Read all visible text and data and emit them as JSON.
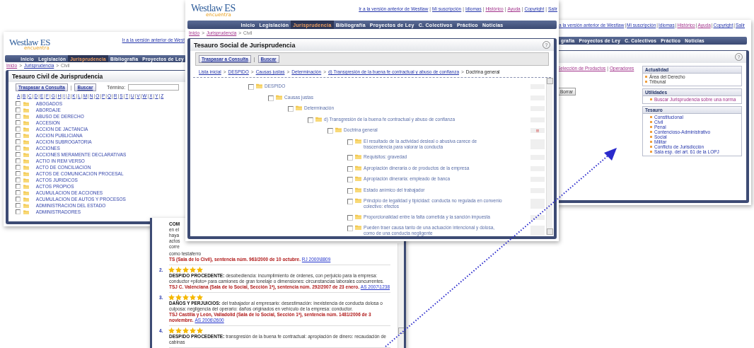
{
  "left_window": {
    "logo": {
      "brand": "Westlaw ES",
      "tagline": "encuentra"
    },
    "top_link": "Ir a la versión anterior de West",
    "nav": [
      {
        "label": "Inicio",
        "selected": false
      },
      {
        "label": "Legislación",
        "selected": false
      },
      {
        "label": "Jurisprudencia",
        "selected": true
      },
      {
        "label": "Bibliografía",
        "selected": false
      },
      {
        "label": "Proyectos de Ley",
        "selected": false
      }
    ],
    "breadcrumb": {
      "separator": ">",
      "items": [
        {
          "label": "Inicio",
          "kind": "visited"
        },
        {
          "label": "Jurisprudencia",
          "kind": "link"
        },
        {
          "label": "Civil",
          "kind": "text"
        }
      ]
    },
    "title": "Tesauro Civil de Jurisprudencia",
    "buttons": [
      "Traspasar a Consulta",
      "Buscar"
    ],
    "button_separator": "|",
    "search": {
      "label": "Término:"
    },
    "letters": {
      "separator": "|",
      "items": [
        "A",
        "B",
        "C",
        "D",
        "E",
        "F",
        "G",
        "H",
        "I",
        "J",
        "K",
        "L",
        "M",
        "N",
        "O",
        "P",
        "Q",
        "R",
        "S",
        "T",
        "U",
        "V",
        "W",
        "X",
        "Y",
        "Z"
      ]
    },
    "items": [
      {
        "label": "ABOGADOS",
        "checked": false
      },
      {
        "label": "ABORDAJE",
        "checked": false
      },
      {
        "label": "ABUSO DE DERECHO",
        "checked": false
      },
      {
        "label": "ACCESION",
        "checked": false
      },
      {
        "label": "ACCION DE JACTANCIA",
        "checked": false
      },
      {
        "label": "ACCION PUBLICIANA",
        "checked": false
      },
      {
        "label": "ACCION SUBROGATORIA",
        "checked": false
      },
      {
        "label": "ACCIONES",
        "checked": false
      },
      {
        "label": "ACCIONES MERAMENTE DECLARATIVAS",
        "checked": false
      },
      {
        "label": "ACTIO IN REM VERSO",
        "checked": false
      },
      {
        "label": "ACTO DE CONCILIACION",
        "checked": false
      },
      {
        "label": "ACTOS DE COMUNICACION PROCESAL",
        "checked": false
      },
      {
        "label": "ACTOS JURIDICOS",
        "checked": false
      },
      {
        "label": "ACTOS PROPIOS",
        "checked": false
      },
      {
        "label": "ACUMULACION DE ACCIONES",
        "checked": false
      },
      {
        "label": "ACUMULACION DE AUTOS Y PROCESOS",
        "checked": false
      },
      {
        "label": "ADMINISTRACION DEL ESTADO",
        "checked": false
      },
      {
        "label": "ADMINISTRADORES",
        "checked": false
      }
    ]
  },
  "right_window": {
    "top_links": {
      "separator": "|",
      "items": [
        {
          "label": "a la versión anterior de Westlaw",
          "visited": false
        },
        {
          "label": "Mi suscripción",
          "visited": false
        },
        {
          "label": "Idiomas",
          "visited": false
        },
        {
          "label": "Histórico",
          "visited": true
        },
        {
          "label": "Ayuda",
          "visited": true
        },
        {
          "label": "Copyright",
          "visited": false
        },
        {
          "label": "Salir",
          "visited": false
        }
      ]
    },
    "nav": [
      {
        "label": "grafía",
        "selected": false
      },
      {
        "label": "Proyectos de Ley",
        "selected": false
      },
      {
        "label": "C. Colectivos",
        "selected": false
      },
      {
        "label": "Práctico",
        "selected": false
      },
      {
        "label": "Noticias",
        "selected": false
      }
    ],
    "help": "?",
    "links": {
      "separator": "|",
      "items": [
        {
          "label": "Selección de Productos",
          "visited": true
        },
        {
          "label": "Operadores",
          "visited": true
        }
      ]
    },
    "button": "Borrar",
    "boxes": [
      {
        "title": "Actualidad",
        "items": [
          {
            "label": "Área del Derecho",
            "kind": "text"
          },
          {
            "label": "Tribunal",
            "kind": "text"
          }
        ]
      },
      {
        "title": "Utilidades",
        "items": [
          {
            "label": "Buscar Jurisprudencia sobre una norma",
            "kind": "visited"
          }
        ]
      },
      {
        "title": "Tesauro",
        "items": [
          {
            "label": "Constitucional",
            "kind": "link"
          },
          {
            "label": "Civil",
            "kind": "link"
          },
          {
            "label": "Penal",
            "kind": "link"
          },
          {
            "label": "Contencioso-Administrativo",
            "kind": "link"
          },
          {
            "label": "Social",
            "kind": "link"
          },
          {
            "label": "Militar",
            "kind": "link"
          },
          {
            "label": "Conflicto de Jurisdicción",
            "kind": "link"
          },
          {
            "label": "Sala esp. del art. 61 de la LOPJ",
            "kind": "link"
          }
        ]
      }
    ]
  },
  "results_window": {
    "fragments": [
      {
        "text": "COM",
        "bold": true
      },
      {
        "text": "en el",
        "bold": false
      },
      {
        "text": "haya",
        "bold": false
      },
      {
        "text": "actos",
        "bold": false
      },
      {
        "text": "corre",
        "bold": false
      }
    ],
    "first_tail": "como testaferro",
    "first_court": "TS (Sala de lo Civil), sentencia núm. 963/2000 de 10 octubre.",
    "first_ref": "RJ 2000\\8809",
    "results": [
      {
        "number": "2.",
        "stars": 5,
        "heading": "DESPIDO PROCEDENTE:",
        "text": "desobediencia: incumplimiento de órdenes, con perjuicio para la empresa: conductor «piloto» para camiones de gran tonelaje o dimensiones: circunstancias laborales concurrentes.",
        "court": "TSJ C. Valenciana (Sala de lo Social, Sección 1ª), sentencia núm. 292/2007 de 23 enero.",
        "ref": "AS 2007\\1238"
      },
      {
        "number": "3.",
        "stars": 5,
        "heading": "DAÑOS Y PERJUICIOS:",
        "text": "del trabajador al empresario: desestimación: inexistencia de conducta dolosa o culposa: negligencia del operario: daños originados en vehículo de la empresa: conductor.",
        "court": "TSJ Castilla y León, Valladolid (Sala de lo Social, Sección 1ª), sentencia núm. 1481/2006 de 3 noviembre.",
        "ref": "AS 2006\\2600"
      },
      {
        "number": "4.",
        "stars": 5,
        "heading": "DESPIDO PROCEDENTE:",
        "text": "transgresión de la buena fe contractual: apropiación de dinero: recaudación de cabinas"
      }
    ]
  },
  "main_window": {
    "logo": {
      "brand": "Westlaw ES",
      "tagline": "encuentra"
    },
    "top_links": {
      "separator": "|",
      "items": [
        {
          "label": "Ir a la versión anterior de Westlaw",
          "visited": false
        },
        {
          "label": "Mi suscripción",
          "visited": false
        },
        {
          "label": "Idiomas",
          "visited": false
        },
        {
          "label": "Histórico",
          "visited": true
        },
        {
          "label": "Ayuda",
          "visited": true
        },
        {
          "label": "Copyright",
          "visited": false
        },
        {
          "label": "Salir",
          "visited": false
        }
      ]
    },
    "nav": [
      {
        "label": "Inicio",
        "selected": false
      },
      {
        "label": "Legislación",
        "selected": false
      },
      {
        "label": "Jurisprudencia",
        "selected": true
      },
      {
        "label": "Bibliografía",
        "selected": false
      },
      {
        "label": "Proyectos de Ley",
        "selected": false
      },
      {
        "label": "C. Colectivos",
        "selected": false
      },
      {
        "label": "Práctico",
        "selected": false
      },
      {
        "label": "Noticias",
        "selected": false
      }
    ],
    "breadcrumb": {
      "separator": ">",
      "items": [
        {
          "label": "Inicio",
          "kind": "visited"
        },
        {
          "label": "Jurisprudencia",
          "kind": "visited"
        },
        {
          "label": "Civil",
          "kind": "text"
        }
      ]
    },
    "title": "Tesauro Social de Jurisprudencia",
    "help": "?",
    "buttons": [
      "Traspasar a Consulta",
      "Buscar"
    ],
    "button_separator": "|",
    "path": {
      "separator": ">",
      "items": [
        {
          "label": "Lista inicial",
          "kind": "link"
        },
        {
          "label": "DESPIDO",
          "kind": "link"
        },
        {
          "label": "Causas justas",
          "kind": "link"
        },
        {
          "label": "Determinación",
          "kind": "link"
        },
        {
          "label": "d) Transgresión de la buena fe contractual y abuso de confianza",
          "kind": "link"
        },
        {
          "label": "Doctrina general",
          "kind": "text"
        }
      ]
    },
    "tree": [
      {
        "label": "DESPIDO",
        "checked": false,
        "children": [
          {
            "label": "Causas justas",
            "checked": false,
            "children": [
              {
                "label": "Determinación",
                "checked": false,
                "children": [
                  {
                    "label": "d) Transgresión de la buena fe contractual y abuso de confianza",
                    "checked": false,
                    "children": [
                      {
                        "label": "Doctrina general",
                        "checked": false,
                        "flag": "!!",
                        "children": [
                          {
                            "label": "El resultado de la actividad desleal o abusiva carece de trascendencia para valorar la conducta",
                            "checked": false
                          },
                          {
                            "label": "Requisitos: gravedad",
                            "checked": false
                          },
                          {
                            "label": "Apropiación dineraria o de productos de la empresa",
                            "checked": false
                          },
                          {
                            "label": "Apropiación dineraria: empleado de banca",
                            "checked": false
                          },
                          {
                            "label": "Estado anímico del trabajador",
                            "checked": false
                          },
                          {
                            "label": "Principio de legalidad y tipicidad: conducta no regulada en convenio colectivo: efectos",
                            "checked": false
                          },
                          {
                            "label": "Proporcionalidad entre la falta cometida y la sanción impuesta",
                            "checked": false
                          },
                          {
                            "label": "Pueden traer causa tanto de una actuación intencional y dolosa, como de una conducta negligente",
                            "checked": false
                          }
                        ]
                      }
                    ]
                  }
                ]
              }
            ]
          }
        ]
      }
    ]
  }
}
